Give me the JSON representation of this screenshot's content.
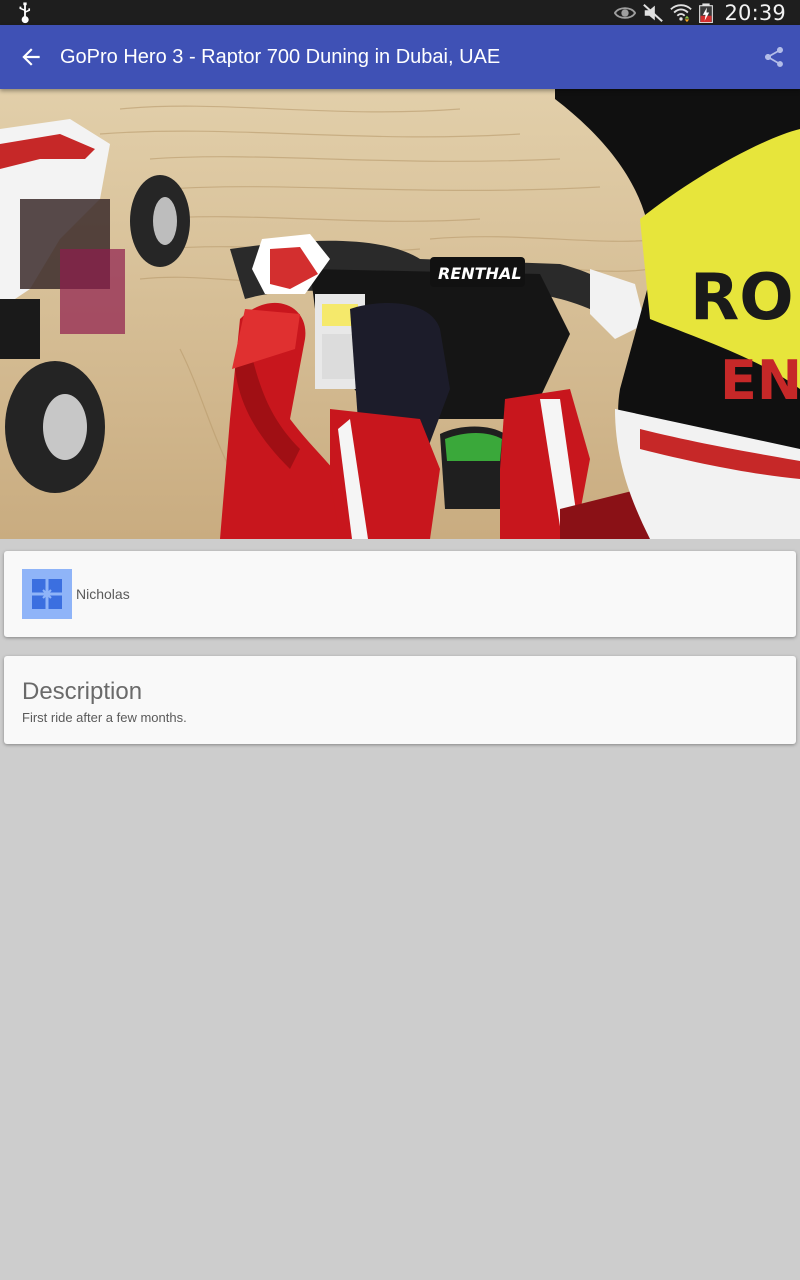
{
  "status_bar": {
    "time": "20:39",
    "icons": [
      "usb-icon",
      "eye-icon",
      "mute-icon",
      "wifi-icon",
      "battery-charging-icon"
    ]
  },
  "toolbar": {
    "title": "GoPro Hero 3 - Raptor 700 Duning in Dubai, UAE",
    "back_icon": "arrow-back-icon",
    "share_icon": "share-icon",
    "background_color": "#3f51b5"
  },
  "video": {
    "overlay_brand_text": "RENTHAL"
  },
  "author": {
    "name": "Nicholas",
    "avatar_color": "#8fb4f8"
  },
  "description": {
    "heading": "Description",
    "text": "First ride after a few months."
  }
}
